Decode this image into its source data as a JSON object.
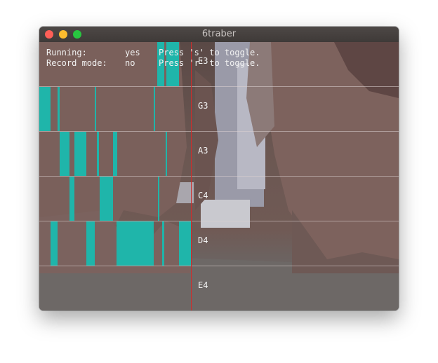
{
  "window": {
    "title": "6traber"
  },
  "status": {
    "running_label": "Running:",
    "running_value": "yes",
    "running_hint": "Press 's' to toggle.",
    "record_label": "Record mode:",
    "record_value": "no",
    "record_hint": "Press 'r' to toggle."
  },
  "notes": [
    "E3",
    "G3",
    "A3",
    "C4",
    "D4",
    "E4"
  ],
  "colors": {
    "note_fill": "#1fb5aa",
    "playhead": "#d22b2b",
    "grid": "#dcd2d2"
  },
  "icons": [
    "close-button",
    "minimize-button",
    "maximize-button"
  ]
}
